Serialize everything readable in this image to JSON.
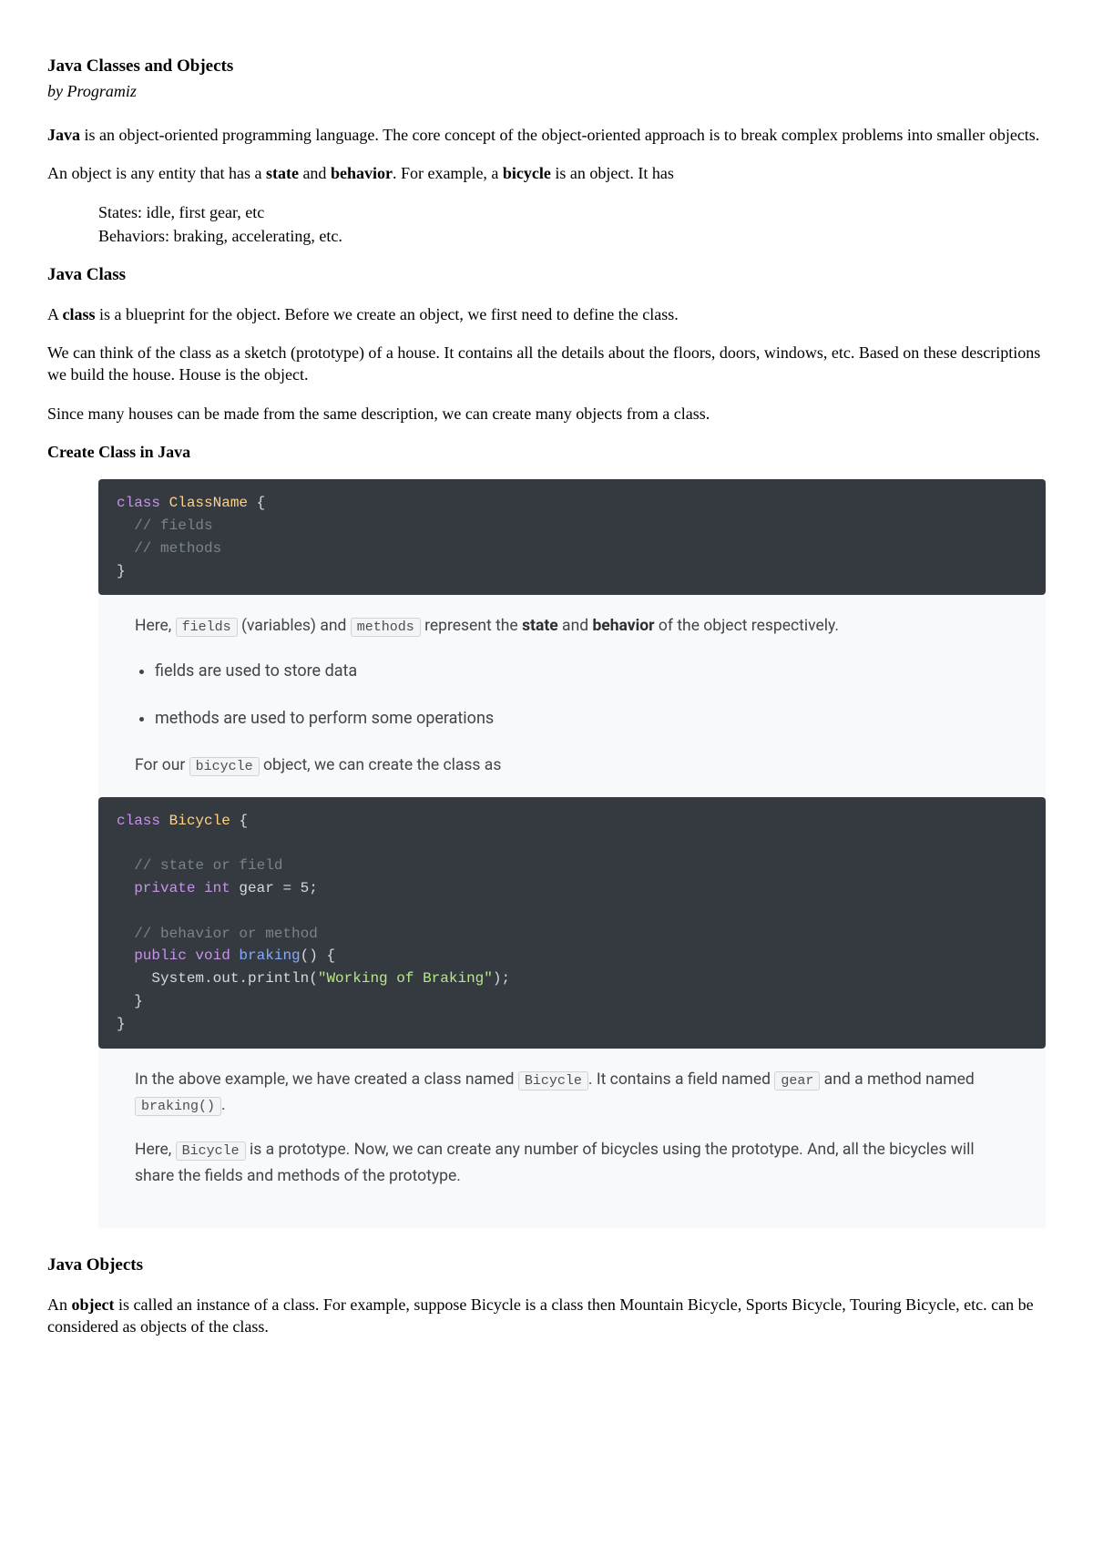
{
  "title": "Java Classes and Objects",
  "byline": "by Programiz",
  "intro": {
    "p1_pre": "Java",
    "p1_rest": " is an object-oriented programming language. The core concept of the object-oriented approach is to break complex problems into smaller objects.",
    "p2_a": "An object is any entity that has a ",
    "p2_state": "state",
    "p2_and": " and ",
    "p2_behavior": "behavior",
    "p2_b": ". For example, a ",
    "p2_bicycle": "bicycle",
    "p2_c": " is an object. It has",
    "states_line": "States: idle, first gear, etc",
    "behaviors_line": "Behaviors: braking, accelerating, etc."
  },
  "java_class": {
    "heading": "Java Class",
    "p1_a": "A ",
    "p1_class": "class",
    "p1_b": " is a blueprint for the object. Before we create an object, we first need to define the class.",
    "p2": "We can think of the class as a sketch (prototype) of a house. It contains all the details about the floors, doors, windows, etc. Based on these descriptions we build the house. House is the object.",
    "p3": "Since many houses can be made from the same description, we can create many objects from a class."
  },
  "create_class": {
    "heading": "Create Class in Java",
    "code1_kw_class": "class",
    "code1_cls": " ClassName ",
    "code1_open": "{",
    "code1_c1": "  // fields",
    "code1_c2": "  // methods",
    "code1_close": "}",
    "panel1_a": "Here, ",
    "panel1_code_fields": "fields",
    "panel1_b": " (variables) and ",
    "panel1_code_methods": "methods",
    "panel1_c": " represent the ",
    "panel1_state": "state",
    "panel1_d": " and ",
    "panel1_behavior": "behavior",
    "panel1_e": " of the object respectively.",
    "li1": "fields are used to store data",
    "li2": "methods are used to perform some operations",
    "panel2_a": "For our ",
    "panel2_code_bicycle": "bicycle",
    "panel2_b": " object, we can create the class as",
    "code2_l1_kw": "class",
    "code2_l1_cls": " Bicycle ",
    "code2_l1_open": "{",
    "code2_blank": "",
    "code2_c1": "  // state or field",
    "code2_l3_kw1": "  private",
    "code2_l3_kw2": " int",
    "code2_l3_rest": " gear = 5;",
    "code2_c2": "  // behavior or method",
    "code2_l6_kw1": "  public",
    "code2_l6_kw2": " void",
    "code2_l6_fn": " braking",
    "code2_l6_rest": "() {",
    "code2_l7_a": "    System.out.println(",
    "code2_l7_str": "\"Working of Braking\"",
    "code2_l7_b": ");",
    "code2_l8": "  }",
    "code2_l9": "}",
    "panel3_a": "In the above example, we have created a class named ",
    "panel3_code_bicycle2": "Bicycle",
    "panel3_b": ". It contains a field named ",
    "panel3_code_gear": "gear",
    "panel3_c": " and a method named ",
    "panel3_code_braking": "braking()",
    "panel3_d": ".",
    "panel4_a": "Here, ",
    "panel4_code_bicycle3": "Bicycle",
    "panel4_b": " is a prototype. Now, we can create any number of bicycles using the prototype. And, all the bicycles will share the fields and methods of the prototype."
  },
  "java_objects": {
    "heading": "Java Objects",
    "p1_a": "An ",
    "p1_object": "object",
    "p1_b": " is called an instance of a class. For example, suppose Bicycle is a class then Mountain Bicycle, Sports Bicycle, Touring Bicycle, etc. can be considered as objects of the class."
  }
}
